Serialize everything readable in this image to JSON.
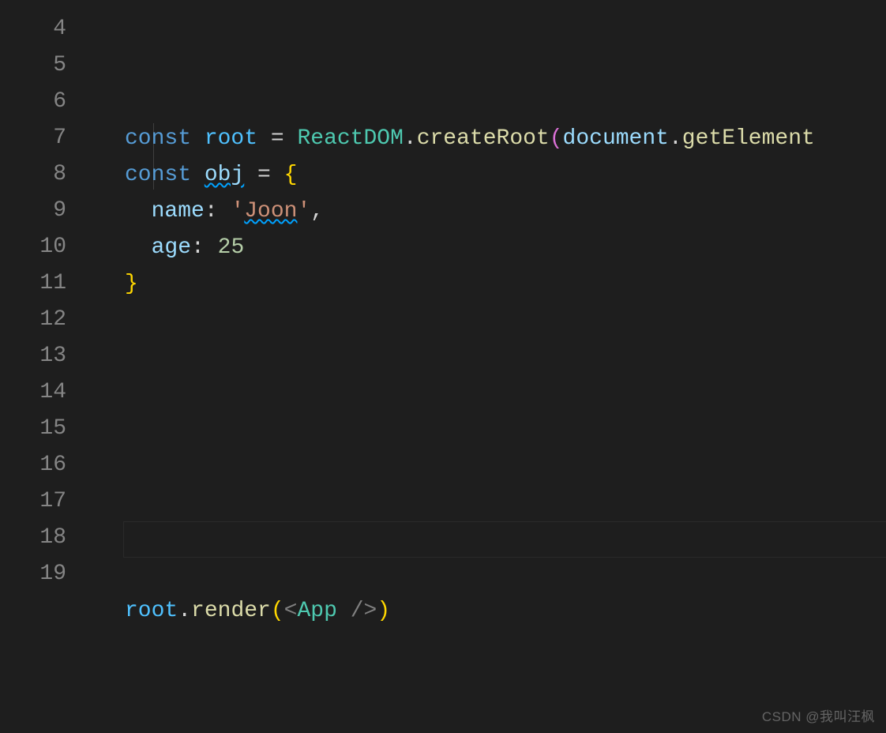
{
  "editor": {
    "firstLine": 4,
    "lastLine": 19,
    "highlightLine": 16,
    "indentGuideTopLine": 7,
    "indentGuideBottomLine": 8
  },
  "code": {
    "l5": {
      "kw": "const",
      "var": "root",
      "eq": " = ",
      "cls": "ReactDOM",
      "dot1": ".",
      "fn": "createRoot",
      "lp": "(",
      "obj": "document",
      "dot2": ".",
      "fn2": "getElement"
    },
    "l6": {
      "kw": "const",
      "var": "obj",
      "eq": " = ",
      "brace": "{"
    },
    "l7": {
      "prop": "name",
      "colon": ": ",
      "q1": "'",
      "str": "Joon",
      "q2": "'",
      "comma": ","
    },
    "l8": {
      "prop": "age",
      "colon": ": ",
      "num": "25"
    },
    "l9": {
      "brace": "}"
    },
    "l18": {
      "obj": "root",
      "dot": ".",
      "fn": "render",
      "lp": "(",
      "lt": "<",
      "comp": "App",
      "slashgt": " />",
      "rp": ")"
    }
  },
  "watermark": "CSDN @我叫汪枫"
}
